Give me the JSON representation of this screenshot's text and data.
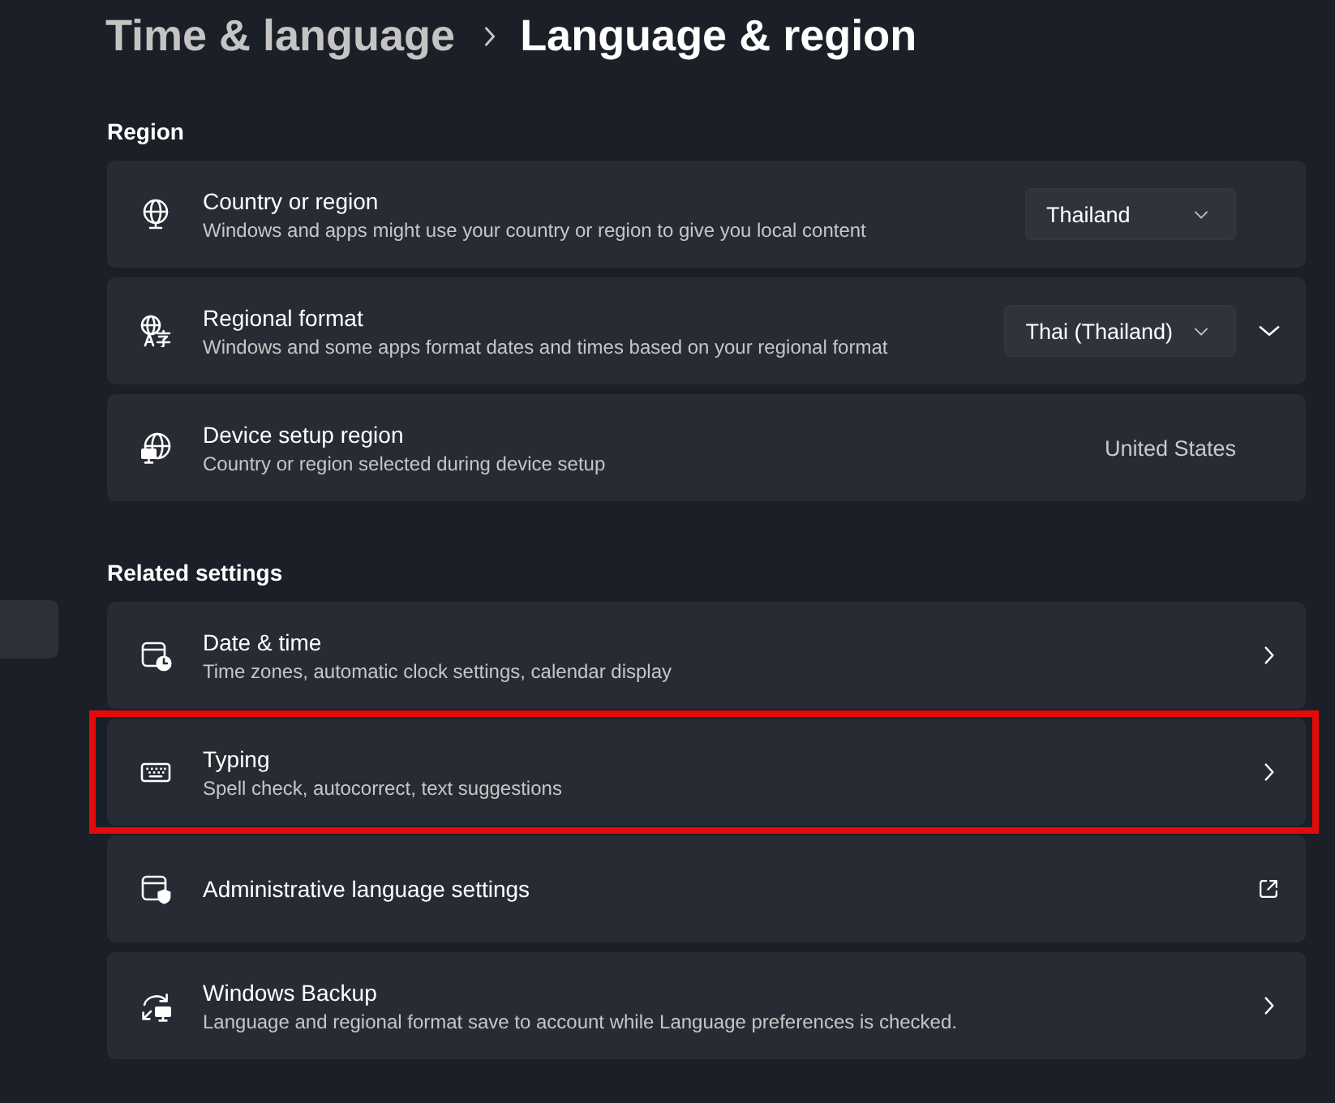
{
  "breadcrumb": {
    "parent": "Time & language",
    "current": "Language & region"
  },
  "nav": {
    "items": [
      {
        "selected": true
      }
    ]
  },
  "sections": [
    {
      "title": "Region",
      "rows": [
        {
          "kind": "dropdown",
          "title": "Country or region",
          "description": "Windows and apps might use your country or region to give you local content",
          "value": "Thailand",
          "highlighted": false
        },
        {
          "kind": "dropdown",
          "title": "Regional format",
          "description": "Windows and some apps format dates and times based on your regional format",
          "value": "Thai (Thailand)",
          "expanded": false,
          "highlighted": false
        },
        {
          "kind": "info",
          "title": "Device setup region",
          "description": "Country or region selected during device setup",
          "value": "United States",
          "highlighted": false
        }
      ]
    },
    {
      "title": "Related settings",
      "rows": [
        {
          "kind": "navigate",
          "title": "Date & time",
          "description": "Time zones, automatic clock settings, calendar display",
          "highlighted": false
        },
        {
          "kind": "navigate",
          "title": "Typing",
          "description": "Spell check, autocorrect, text suggestions",
          "highlighted": true
        },
        {
          "kind": "external",
          "title": "Administrative language settings",
          "highlighted": false
        },
        {
          "kind": "navigate",
          "title": "Windows Backup",
          "description": "Language and regional format save to account while Language preferences is checked.",
          "highlighted": false
        }
      ]
    }
  ]
}
